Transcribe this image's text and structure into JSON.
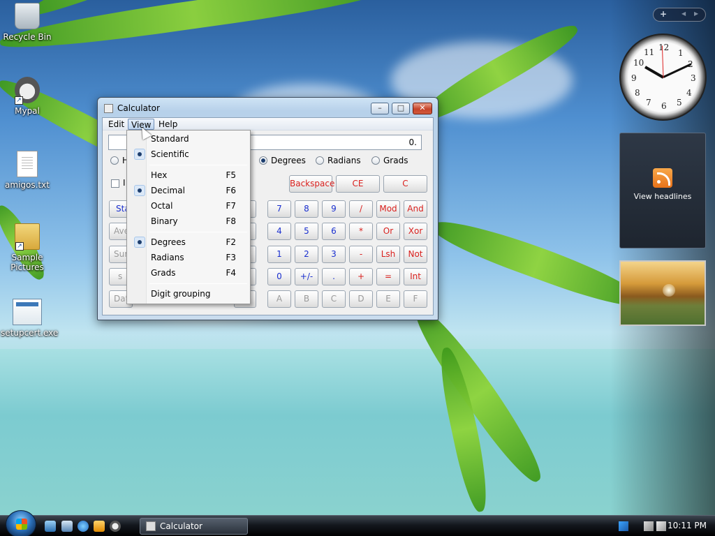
{
  "desktop": {
    "icons": [
      {
        "label": "Recycle Bin",
        "icon": "recycle-bin-icon"
      },
      {
        "label": "Mypal",
        "icon": "mypal-icon"
      },
      {
        "label": "amigos.txt",
        "icon": "text-file-icon"
      },
      {
        "label": "Sample Pictures",
        "icon": "folder-icon"
      },
      {
        "label": "setupcert.exe",
        "icon": "exe-file-icon"
      }
    ]
  },
  "window": {
    "title": "Calculator",
    "controls": {
      "minimize": "–",
      "maximize": "□",
      "close": "✕"
    },
    "menu": {
      "edit": "Edit",
      "view": "View",
      "help": "Help"
    },
    "display_value": "0.",
    "base_radio_partial": "H",
    "angle_units": [
      {
        "label": "Degrees",
        "selected": true
      },
      {
        "label": "Radians",
        "selected": false
      },
      {
        "label": "Grads",
        "selected": false
      }
    ],
    "inv_partial": "I",
    "top_buttons": [
      "Backspace",
      "CE",
      "C"
    ],
    "left_partial_buttons": [
      "Sta",
      "Ave",
      "Sum",
      "s",
      "Dat"
    ],
    "keypad": [
      [
        "7",
        "8",
        "9",
        "/",
        "Mod",
        "And"
      ],
      [
        "4",
        "5",
        "6",
        "*",
        "Or",
        "Xor"
      ],
      [
        "1",
        "2",
        "3",
        "-",
        "Lsh",
        "Not"
      ],
      [
        "0",
        "+/-",
        ".",
        "+",
        "=",
        "Int"
      ],
      [
        "A",
        "B",
        "C",
        "D",
        "E",
        "F"
      ]
    ]
  },
  "view_menu": {
    "groups": [
      [
        {
          "label": "Standard",
          "key": "",
          "checked": false
        },
        {
          "label": "Scientific",
          "key": "",
          "checked": true
        }
      ],
      [
        {
          "label": "Hex",
          "key": "F5",
          "checked": false
        },
        {
          "label": "Decimal",
          "key": "F6",
          "checked": true
        },
        {
          "label": "Octal",
          "key": "F7",
          "checked": false
        },
        {
          "label": "Binary",
          "key": "F8",
          "checked": false
        }
      ],
      [
        {
          "label": "Degrees",
          "key": "F2",
          "checked": true
        },
        {
          "label": "Radians",
          "key": "F3",
          "checked": false
        },
        {
          "label": "Grads",
          "key": "F4",
          "checked": false
        }
      ],
      [
        {
          "label": "Digit grouping",
          "key": "",
          "checked": false
        }
      ]
    ]
  },
  "gadgets": {
    "toolbar": {
      "add": "+",
      "prev": "◀",
      "next": "▶"
    },
    "clock_numbers": [
      "12",
      "1",
      "2",
      "3",
      "4",
      "5",
      "6",
      "7",
      "8",
      "9",
      "10",
      "11"
    ],
    "feed_label": "View headlines"
  },
  "taskbar": {
    "task_label": "Calculator",
    "time": "10:11 PM"
  },
  "colors": {
    "digit_text": "#1a2fcf",
    "operator_text": "#d9211e",
    "disabled_text": "#9a9a9a"
  }
}
